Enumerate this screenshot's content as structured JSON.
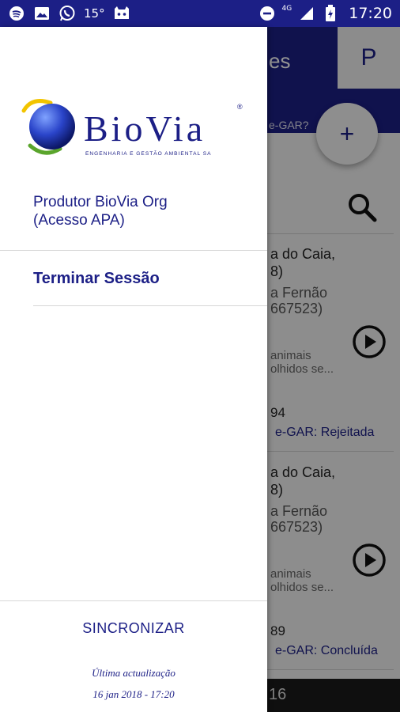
{
  "statusbar": {
    "temperature": "15°",
    "network": "4G",
    "time": "17:20",
    "left_icons": [
      "spotify-icon",
      "image-icon",
      "whatsapp-icon"
    ],
    "right_icons": [
      "do-not-disturb-icon",
      "signal-icon",
      "battery-icon"
    ]
  },
  "drawer": {
    "logo_text": "BioVia",
    "logo_tagline": "ENGENHARIA E GESTÃO AMBIENTAL SA",
    "user_line1": "Produtor BioVia Org",
    "user_line2": "(Acesso APA)",
    "logout_label": "Terminar Sessão",
    "sync_label": "SINCRONIZAR",
    "last_update_label": "Última actualização",
    "last_update_value": "16 jan 2018 - 17:20"
  },
  "background": {
    "header_title_partial": "es",
    "p_button": "P",
    "subheader_partial": "e-GAR?",
    "fab_label": "+",
    "cards": [
      {
        "line1": "a do Caia,\n8)",
        "line2": "a Fernão\n667523)",
        "line3": "animais\nolhidos se...",
        "number": "94",
        "status": "e-GAR: Rejeitada"
      },
      {
        "line1": "a do Caia,\n8)",
        "line2": "a Fernão\n667523)",
        "line3": "animais\nolhidos se...",
        "number": "89",
        "status": "e-GAR: Concluída"
      }
    ],
    "bottom_partial": "16"
  },
  "colors": {
    "brand": "#1c1f86",
    "accent_yellow": "#f2c400",
    "accent_green": "#5aa52c"
  }
}
